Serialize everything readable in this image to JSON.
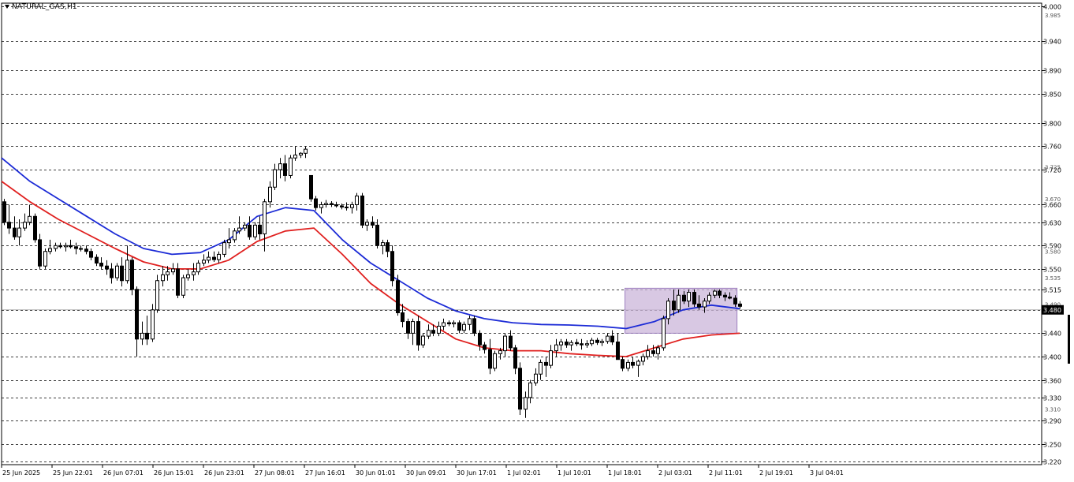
{
  "chart_title": "NATURAL_GAS,H1",
  "colors": {
    "background": "#ffffff",
    "grid": "#000000",
    "candle_up_fill": "#ffffff",
    "candle_down_fill": "#000000",
    "candle_outline": "#000000",
    "ma_fast": "#1c2bd6",
    "ma_slow": "#e0201f",
    "range_box_fill": "#cbb6da",
    "range_box_stroke": "#9d7fbf",
    "price_marker_bg": "#000000",
    "price_marker_text": "#ffffff"
  },
  "chart_data": {
    "type": "candlestick",
    "title": "NATURAL_GAS,H1",
    "ylim": [
      3.215,
      4.005
    ],
    "price_levels": [
      4.0,
      3.94,
      3.89,
      3.85,
      3.8,
      3.76,
      3.72,
      3.66,
      3.63,
      3.59,
      3.55,
      3.515,
      3.48,
      3.44,
      3.4,
      3.36,
      3.33,
      3.29,
      3.25,
      3.22
    ],
    "secondary_ticks": [
      "3.985",
      "3.725",
      "3.670",
      "3.580",
      "3.535",
      "3.490",
      "3.310"
    ],
    "x_labels": [
      "25 Jun 2025",
      "25 Jun 22:01",
      "26 Jun 07:01",
      "26 Jun 15:01",
      "26 Jun 23:01",
      "27 Jun 08:01",
      "27 Jun 16:01",
      "30 Jun 01:01",
      "30 Jun 09:01",
      "30 Jun 17:01",
      "1 Jul 02:01",
      "1 Jul 10:01",
      "1 Jul 18:01",
      "2 Jul 03:01",
      "2 Jul 11:01",
      "2 Jul 19:01",
      "3 Jul 04:01"
    ],
    "candles": [
      [
        3.665,
        3.67,
        3.625,
        3.63
      ],
      [
        3.63,
        3.66,
        3.61,
        3.62
      ],
      [
        3.62,
        3.64,
        3.6,
        3.605
      ],
      [
        3.605,
        3.635,
        3.59,
        3.62
      ],
      [
        3.62,
        3.645,
        3.615,
        3.63
      ],
      [
        3.63,
        3.66,
        3.625,
        3.64
      ],
      [
        3.64,
        3.645,
        3.595,
        3.6
      ],
      [
        3.6,
        3.61,
        3.55,
        3.555
      ],
      [
        3.555,
        3.585,
        3.55,
        3.58
      ],
      [
        3.58,
        3.6,
        3.575,
        3.585
      ],
      [
        3.585,
        3.595,
        3.58,
        3.59
      ],
      [
        3.59,
        3.595,
        3.585,
        3.588
      ],
      [
        3.588,
        3.595,
        3.58,
        3.59
      ],
      [
        3.59,
        3.6,
        3.585,
        3.588
      ],
      [
        3.588,
        3.595,
        3.575,
        3.585
      ],
      [
        3.585,
        3.59,
        3.58,
        3.584
      ],
      [
        3.584,
        3.59,
        3.575,
        3.58
      ],
      [
        3.58,
        3.585,
        3.565,
        3.57
      ],
      [
        3.57,
        3.575,
        3.555,
        3.56
      ],
      [
        3.56,
        3.57,
        3.55,
        3.555
      ],
      [
        3.555,
        3.565,
        3.54,
        3.55
      ],
      [
        3.55,
        3.56,
        3.525,
        3.535
      ],
      [
        3.535,
        3.56,
        3.53,
        3.555
      ],
      [
        3.555,
        3.57,
        3.52,
        3.53
      ],
      [
        3.53,
        3.59,
        3.525,
        3.565
      ],
      [
        3.565,
        3.57,
        3.505,
        3.515
      ],
      [
        3.515,
        3.52,
        3.4,
        3.43
      ],
      [
        3.43,
        3.46,
        3.42,
        3.44
      ],
      [
        3.44,
        3.47,
        3.42,
        3.43
      ],
      [
        3.43,
        3.49,
        3.425,
        3.48
      ],
      [
        3.48,
        3.54,
        3.475,
        3.53
      ],
      [
        3.53,
        3.555,
        3.52,
        3.54
      ],
      [
        3.54,
        3.555,
        3.53,
        3.545
      ],
      [
        3.545,
        3.56,
        3.54,
        3.55
      ],
      [
        3.55,
        3.56,
        3.5,
        3.505
      ],
      [
        3.505,
        3.54,
        3.5,
        3.535
      ],
      [
        3.535,
        3.55,
        3.53,
        3.54
      ],
      [
        3.54,
        3.56,
        3.53,
        3.545
      ],
      [
        3.545,
        3.565,
        3.54,
        3.56
      ],
      [
        3.56,
        3.575,
        3.555,
        3.565
      ],
      [
        3.565,
        3.58,
        3.56,
        3.57
      ],
      [
        3.57,
        3.58,
        3.562,
        3.566
      ],
      [
        3.566,
        3.58,
        3.56,
        3.575
      ],
      [
        3.575,
        3.6,
        3.57,
        3.595
      ],
      [
        3.595,
        3.62,
        3.585,
        3.6
      ],
      [
        3.6,
        3.62,
        3.595,
        3.615
      ],
      [
        3.615,
        3.64,
        3.61,
        3.62
      ],
      [
        3.62,
        3.63,
        3.615,
        3.625
      ],
      [
        3.625,
        3.64,
        3.6,
        3.605
      ],
      [
        3.605,
        3.63,
        3.6,
        3.625
      ],
      [
        3.625,
        3.64,
        3.6,
        3.61
      ],
      [
        3.61,
        3.67,
        3.58,
        3.665
      ],
      [
        3.665,
        3.7,
        3.655,
        3.69
      ],
      [
        3.69,
        3.73,
        3.685,
        3.72
      ],
      [
        3.72,
        3.74,
        3.705,
        3.73
      ],
      [
        3.73,
        3.745,
        3.7,
        3.71
      ],
      [
        3.71,
        3.745,
        3.705,
        3.74
      ],
      [
        3.74,
        3.76,
        3.735,
        3.745
      ],
      [
        3.745,
        3.75,
        3.74,
        3.748
      ],
      [
        3.748,
        3.76,
        3.74,
        3.755
      ],
      [
        3.71,
        3.71,
        3.665,
        3.67
      ],
      [
        3.67,
        3.675,
        3.65,
        3.655
      ],
      [
        3.655,
        3.665,
        3.645,
        3.66
      ],
      [
        3.66,
        3.668,
        3.655,
        3.662
      ],
      [
        3.662,
        3.666,
        3.656,
        3.66
      ],
      [
        3.66,
        3.665,
        3.655,
        3.658
      ],
      [
        3.658,
        3.662,
        3.652,
        3.656
      ],
      [
        3.656,
        3.664,
        3.65,
        3.655
      ],
      [
        3.655,
        3.665,
        3.645,
        3.66
      ],
      [
        3.66,
        3.68,
        3.65,
        3.675
      ],
      [
        3.675,
        3.68,
        3.62,
        3.625
      ],
      [
        3.625,
        3.635,
        3.615,
        3.63
      ],
      [
        3.63,
        3.64,
        3.62,
        3.625
      ],
      [
        3.625,
        3.635,
        3.585,
        3.59
      ],
      [
        3.59,
        3.6,
        3.575,
        3.595
      ],
      [
        3.595,
        3.6,
        3.57,
        3.58
      ],
      [
        3.58,
        3.59,
        3.52,
        3.53
      ],
      [
        3.53,
        3.54,
        3.47,
        3.475
      ],
      [
        3.475,
        3.49,
        3.45,
        3.46
      ],
      [
        3.46,
        3.465,
        3.43,
        3.44
      ],
      [
        3.44,
        3.465,
        3.42,
        3.46
      ],
      [
        3.46,
        3.47,
        3.41,
        3.42
      ],
      [
        3.42,
        3.44,
        3.415,
        3.435
      ],
      [
        3.435,
        3.455,
        3.43,
        3.445
      ],
      [
        3.445,
        3.455,
        3.435,
        3.44
      ],
      [
        3.44,
        3.46,
        3.435,
        3.452
      ],
      [
        3.452,
        3.465,
        3.445,
        3.458
      ],
      [
        3.458,
        3.462,
        3.452,
        3.456
      ],
      [
        3.456,
        3.462,
        3.45,
        3.458
      ],
      [
        3.458,
        3.462,
        3.44,
        3.445
      ],
      [
        3.445,
        3.46,
        3.44,
        3.455
      ],
      [
        3.455,
        3.47,
        3.445,
        3.465
      ],
      [
        3.465,
        3.47,
        3.435,
        3.44
      ],
      [
        3.44,
        3.445,
        3.41,
        3.42
      ],
      [
        3.42,
        3.425,
        3.405,
        3.412
      ],
      [
        3.412,
        3.43,
        3.37,
        3.38
      ],
      [
        3.38,
        3.41,
        3.375,
        3.405
      ],
      [
        3.405,
        3.415,
        3.395,
        3.41
      ],
      [
        3.41,
        3.44,
        3.4,
        3.435
      ],
      [
        3.435,
        3.445,
        3.41,
        3.415
      ],
      [
        3.415,
        3.42,
        3.37,
        3.38
      ],
      [
        3.38,
        3.39,
        3.3,
        3.31
      ],
      [
        3.31,
        3.34,
        3.295,
        3.33
      ],
      [
        3.33,
        3.36,
        3.32,
        3.355
      ],
      [
        3.355,
        3.38,
        3.35,
        3.37
      ],
      [
        3.37,
        3.395,
        3.36,
        3.39
      ],
      [
        3.39,
        3.4,
        3.365,
        3.385
      ],
      [
        3.385,
        3.42,
        3.38,
        3.41
      ],
      [
        3.41,
        3.43,
        3.4,
        3.42
      ],
      [
        3.42,
        3.43,
        3.41,
        3.425
      ],
      [
        3.425,
        3.43,
        3.415,
        3.42
      ],
      [
        3.42,
        3.428,
        3.41,
        3.424
      ],
      [
        3.424,
        3.43,
        3.418,
        3.422
      ],
      [
        3.422,
        3.43,
        3.412,
        3.42
      ],
      [
        3.42,
        3.428,
        3.415,
        3.422
      ],
      [
        3.422,
        3.432,
        3.418,
        3.428
      ],
      [
        3.428,
        3.432,
        3.42,
        3.424
      ],
      [
        3.424,
        3.43,
        3.418,
        3.426
      ],
      [
        3.426,
        3.44,
        3.422,
        3.435
      ],
      [
        3.435,
        3.445,
        3.42,
        3.425
      ],
      [
        3.425,
        3.44,
        3.4,
        3.395
      ],
      [
        3.395,
        3.4,
        3.375,
        3.38
      ],
      [
        3.38,
        3.395,
        3.375,
        3.39
      ],
      [
        3.39,
        3.4,
        3.38,
        3.385
      ],
      [
        3.385,
        3.395,
        3.365,
        3.392
      ],
      [
        3.392,
        3.405,
        3.385,
        3.4
      ],
      [
        3.4,
        3.42,
        3.395,
        3.41
      ],
      [
        3.41,
        3.42,
        3.4,
        3.405
      ],
      [
        3.405,
        3.42,
        3.395,
        3.415
      ],
      [
        3.415,
        3.47,
        3.41,
        3.465
      ],
      [
        3.465,
        3.5,
        3.455,
        3.495
      ],
      [
        3.495,
        3.515,
        3.47,
        3.48
      ],
      [
        3.48,
        3.515,
        3.475,
        3.505
      ],
      [
        3.505,
        3.512,
        3.49,
        3.495
      ],
      [
        3.495,
        3.515,
        3.485,
        3.51
      ],
      [
        3.51,
        3.515,
        3.485,
        3.49
      ],
      [
        3.49,
        3.505,
        3.48,
        3.485
      ],
      [
        3.485,
        3.5,
        3.475,
        3.495
      ],
      [
        3.495,
        3.51,
        3.49,
        3.505
      ],
      [
        3.505,
        3.515,
        3.5,
        3.512
      ],
      [
        3.512,
        3.515,
        3.5,
        3.505
      ],
      [
        3.505,
        3.51,
        3.495,
        3.502
      ],
      [
        3.502,
        3.51,
        3.498,
        3.5
      ],
      [
        3.5,
        3.505,
        3.485,
        3.49
      ],
      [
        3.49,
        3.495,
        3.482,
        3.486
      ]
    ],
    "ma_fast": {
      "name": "",
      "values": [
        3.74,
        3.7,
        3.67,
        3.64,
        3.61,
        3.585,
        3.575,
        3.578,
        3.6,
        3.64,
        3.655,
        3.65,
        3.6,
        3.56,
        3.53,
        3.5,
        3.478,
        3.465,
        3.458,
        3.455,
        3.454,
        3.452,
        3.448,
        3.46,
        3.48,
        3.488,
        3.482
      ]
    },
    "ma_slow": {
      "name": "",
      "values": [
        3.7,
        3.665,
        3.635,
        3.61,
        3.585,
        3.562,
        3.55,
        3.55,
        3.565,
        3.597,
        3.615,
        3.62,
        3.575,
        3.525,
        3.49,
        3.46,
        3.43,
        3.415,
        3.41,
        3.41,
        3.405,
        3.402,
        3.4,
        3.415,
        3.43,
        3.437,
        3.44
      ]
    },
    "range_box": {
      "x_from_candle": 122,
      "x_to_candle": 143,
      "price_top": 3.517,
      "price_bottom": 3.44
    },
    "current_price": 3.48
  }
}
